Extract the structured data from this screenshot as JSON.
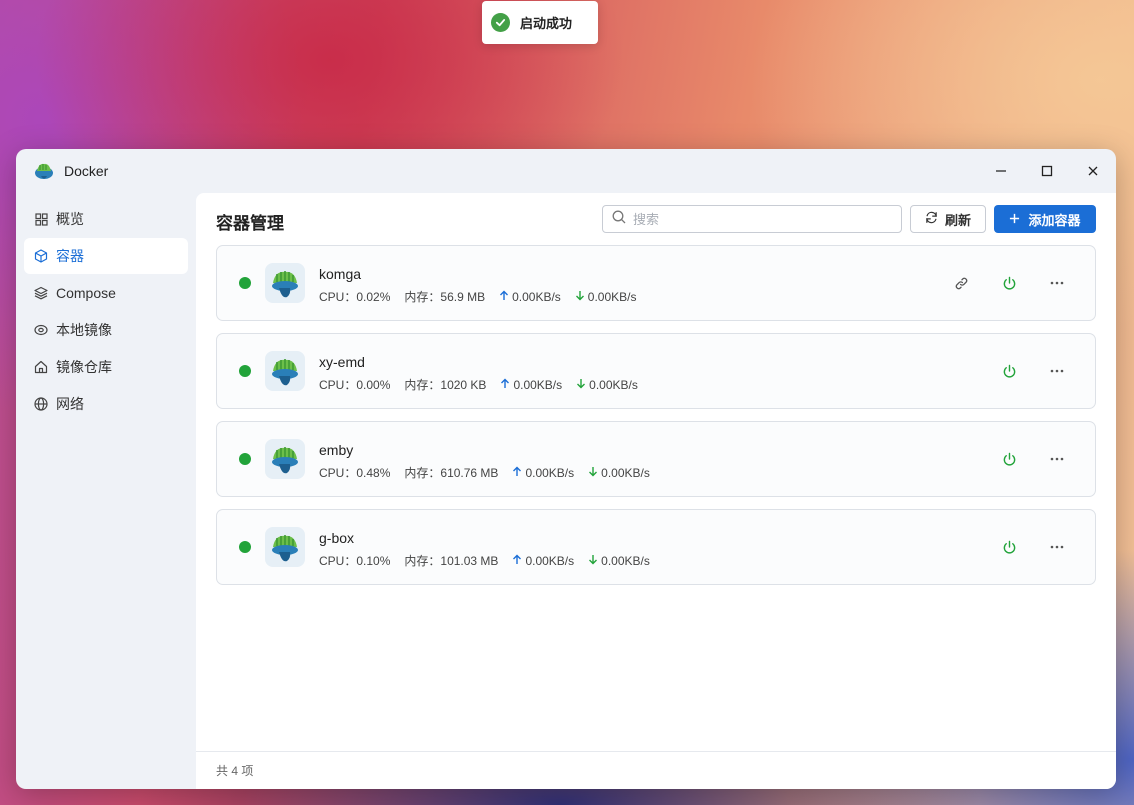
{
  "toast": {
    "text": "启动成功"
  },
  "window": {
    "title": "Docker"
  },
  "sidebar": {
    "items": [
      {
        "label": "概览",
        "icon": "grid-icon",
        "active": false
      },
      {
        "label": "容器",
        "icon": "cube-icon",
        "active": true
      },
      {
        "label": "Compose",
        "icon": "layers-icon",
        "active": false
      },
      {
        "label": "本地镜像",
        "icon": "disc-icon",
        "active": false
      },
      {
        "label": "镜像仓库",
        "icon": "home-icon",
        "active": false
      },
      {
        "label": "网络",
        "icon": "globe-icon",
        "active": false
      }
    ]
  },
  "main": {
    "title": "容器管理",
    "search": {
      "placeholder": "搜索",
      "value": ""
    },
    "refresh_label": "刷新",
    "add_label": "添加容器",
    "cpu_label": "CPU：",
    "mem_label": "内存：",
    "containers": [
      {
        "name": "komga",
        "cpu": "0.02%",
        "mem": "56.9 MB",
        "up": "0.00KB/s",
        "down": "0.00KB/s",
        "has_link": true,
        "status_color": "#22a33a"
      },
      {
        "name": "xy-emd",
        "cpu": "0.00%",
        "mem": "1020 KB",
        "up": "0.00KB/s",
        "down": "0.00KB/s",
        "has_link": false,
        "status_color": "#22a33a"
      },
      {
        "name": "emby",
        "cpu": "0.48%",
        "mem": "610.76 MB",
        "up": "0.00KB/s",
        "down": "0.00KB/s",
        "has_link": false,
        "status_color": "#22a33a"
      },
      {
        "name": "g-box",
        "cpu": "0.10%",
        "mem": "101.03 MB",
        "up": "0.00KB/s",
        "down": "0.00KB/s",
        "has_link": false,
        "status_color": "#22a33a"
      }
    ],
    "footer": "共 4 项"
  },
  "colors": {
    "accent": "#1b6ed6",
    "running": "#22a33a",
    "power": "#22a33a"
  }
}
